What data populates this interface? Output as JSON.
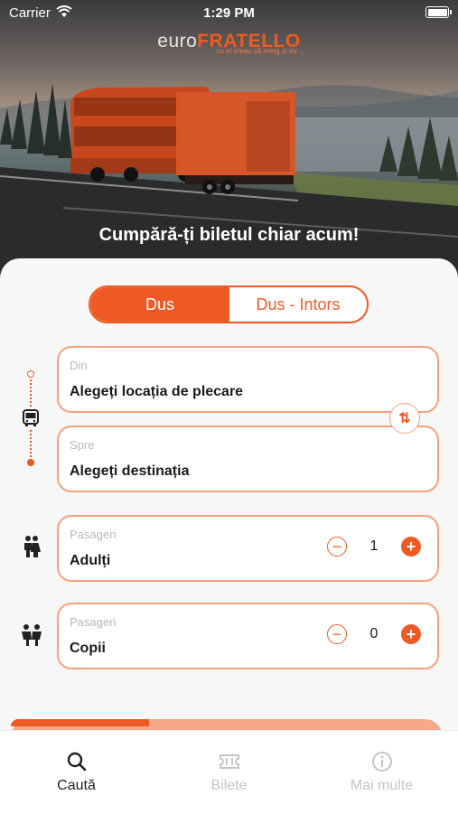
{
  "status_bar": {
    "carrier": "Carrier",
    "time": "1:29 PM"
  },
  "brand": {
    "name_part1": "euro",
    "name_part2": "FRATELLO",
    "tagline": "cu el vreau să merg și eu ..."
  },
  "hero": {
    "headline": "Cumpără-ți biletul chiar acum!"
  },
  "trip_type": {
    "options": [
      "Dus",
      "Dus - Intors"
    ],
    "selected": "Dus"
  },
  "from": {
    "label": "Din",
    "value": "Alegeți locația de plecare"
  },
  "to": {
    "label": "Spre",
    "value": "Alegeți destinația"
  },
  "adults": {
    "label": "Pasageri",
    "value": "Adulți",
    "count": "1"
  },
  "children": {
    "label": "Pasageri",
    "value": "Copii",
    "count": "0"
  },
  "tabs": [
    {
      "label": "Caută",
      "icon": "search-icon",
      "active": true
    },
    {
      "label": "Bilete",
      "icon": "ticket-icon",
      "active": false
    },
    {
      "label": "Mai multe",
      "icon": "info-icon",
      "active": false
    }
  ],
  "colors": {
    "accent": "#ee5a24",
    "accent_light": "#f3a37c",
    "inactive": "#c5c5c5"
  }
}
